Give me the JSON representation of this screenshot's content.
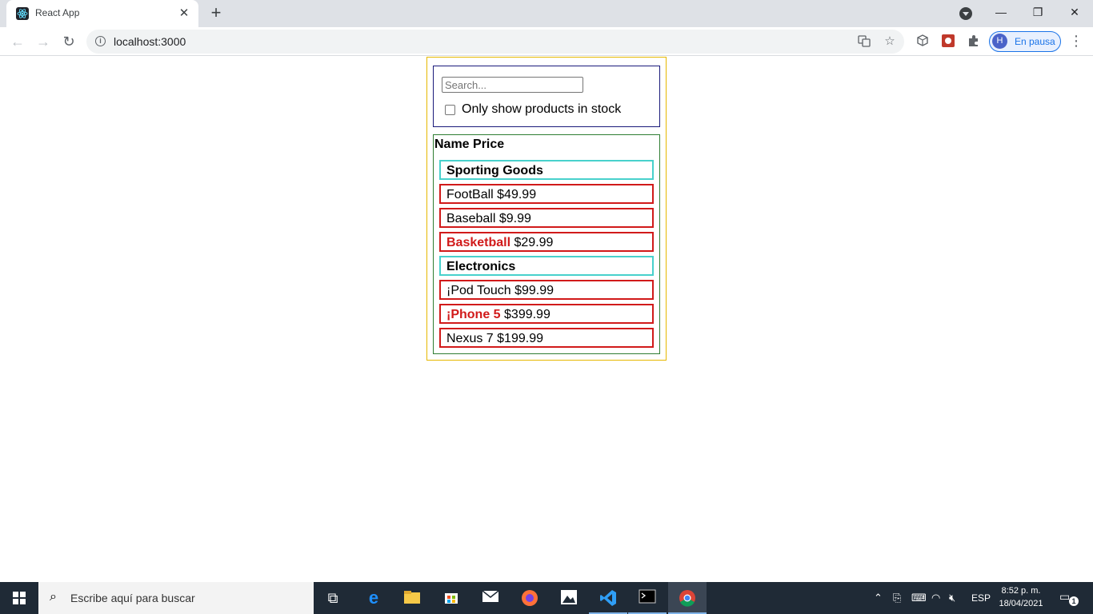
{
  "browser": {
    "tab_title": "React App",
    "tab_close": "✕",
    "new_tab": "+",
    "url": "localhost:3000",
    "profile_initial": "H",
    "profile_label": "En pausa",
    "window": {
      "minimize": "—",
      "maximize": "❐",
      "close": "✕"
    },
    "nav": {
      "back": "←",
      "forward": "→",
      "reload": "↻"
    },
    "menu": "⋮"
  },
  "app": {
    "search": {
      "placeholder": "Search...",
      "value": ""
    },
    "in_stock_only": {
      "label": "Only show products in stock",
      "checked": false
    },
    "table": {
      "header": "Name Price",
      "rows": [
        {
          "type": "category",
          "name": "Sporting Goods"
        },
        {
          "type": "product",
          "name": "FootBall",
          "price": "$49.99",
          "stocked": true
        },
        {
          "type": "product",
          "name": "Baseball",
          "price": "$9.99",
          "stocked": true
        },
        {
          "type": "product",
          "name": "Basketball",
          "price": "$29.99",
          "stocked": false
        },
        {
          "type": "category",
          "name": "Electronics"
        },
        {
          "type": "product",
          "name": "¡Pod Touch",
          "price": "$99.99",
          "stocked": true
        },
        {
          "type": "product",
          "name": "¡Phone 5",
          "price": "$399.99",
          "stocked": false
        },
        {
          "type": "product",
          "name": "Nexus 7",
          "price": "$199.99",
          "stocked": true
        }
      ]
    },
    "colors": {
      "app_border": "#e6b800",
      "searchbar_border": "#1a1a7a",
      "table_border": "#2e7d32",
      "category_border": "#48d1cc",
      "product_border": "#d11a1a",
      "out_of_stock_text": "#d11a1a"
    }
  },
  "taskbar": {
    "search_placeholder": "Escribe aquí para buscar",
    "apps": [
      "task-view-icon",
      "edge-icon",
      "file-explorer-icon",
      "store-icon",
      "mail-icon",
      "firefox-icon",
      "photos-icon",
      "vscode-icon",
      "terminal-icon",
      "chrome-icon"
    ],
    "language": "ESP",
    "time": "8:52 p. m.",
    "date": "18/04/2021",
    "notification_count": "1"
  }
}
